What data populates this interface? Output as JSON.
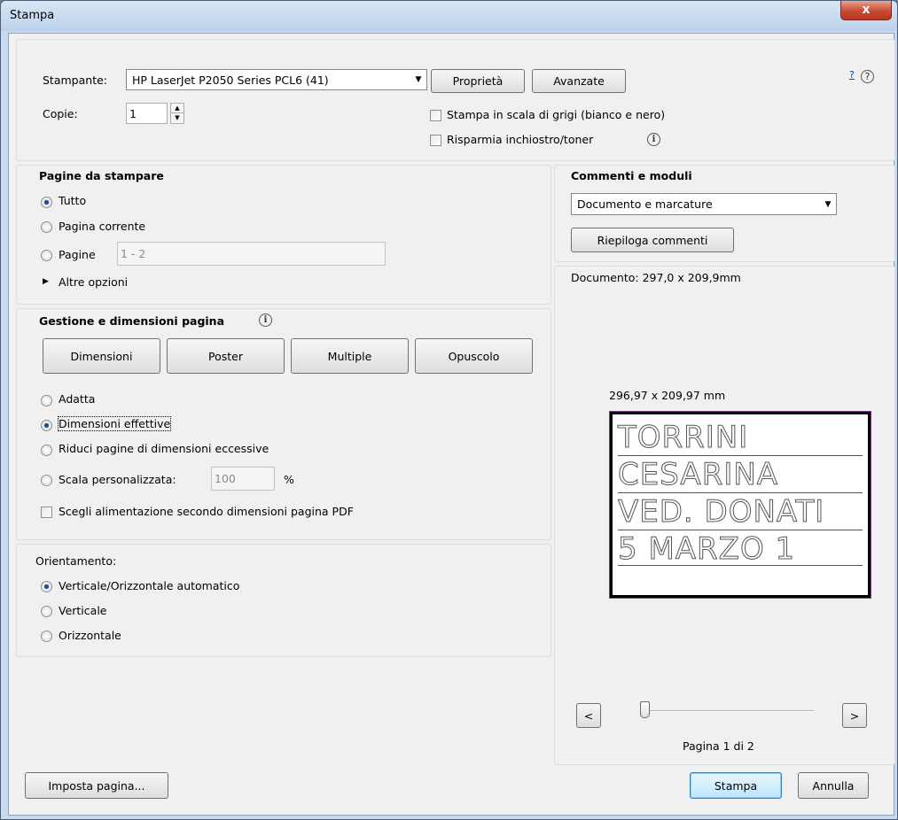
{
  "window": {
    "title": "Stampa",
    "close_label": "x"
  },
  "printer": {
    "label": "Stampante:",
    "selected": "HP LaserJet P2050 Series PCL6 (41)",
    "properties_label": "Proprietà",
    "advanced_label": "Avanzate",
    "help_label": "?",
    "copies_label": "Copie:",
    "copies_value": "1",
    "grayscale_label": "Stampa in scala di grigi (bianco e nero)",
    "save_ink_label": "Risparmia inchiostro/toner"
  },
  "pages_to_print": {
    "heading": "Pagine da stampare",
    "all_label": "Tutto",
    "current_label": "Pagina corrente",
    "pages_label": "Pagine",
    "pages_value": "1 - 2",
    "more_options_label": "Altre opzioni"
  },
  "page_handling": {
    "heading": "Gestione e dimensioni pagina",
    "size_label": "Dimensioni",
    "poster_label": "Poster",
    "multiple_label": "Multiple",
    "booklet_label": "Opuscolo",
    "fit_label": "Adatta",
    "actual_size_label": "Dimensioni effettive",
    "shrink_label": "Riduci pagine di dimensioni eccessive",
    "custom_scale_label": "Scala personalizzata:",
    "custom_scale_value": "100",
    "percent_label": "%",
    "paper_source_label": "Scegli alimentazione secondo dimensioni pagina PDF"
  },
  "orientation": {
    "heading": "Orientamento:",
    "auto_label": "Verticale/Orizzontale automatico",
    "portrait_label": "Verticale",
    "landscape_label": "Orizzontale"
  },
  "comments": {
    "heading": "Commenti e moduli",
    "selected": "Documento e marcature",
    "summarize_label": "Riepiloga commenti"
  },
  "preview": {
    "document_size": "Documento: 297,0 x 209,9mm",
    "page_size": "296,97 x 209,97 mm",
    "preview_lines": [
      "TORRINI",
      "CESARINA",
      "VED. DONATI",
      "5 MARZO 1"
    ],
    "prev_label": "<",
    "next_label": ">",
    "page_status": "Pagina 1 di 2"
  },
  "footer": {
    "page_setup_label": "Imposta pagina...",
    "print_label": "Stampa",
    "cancel_label": "Annulla"
  }
}
